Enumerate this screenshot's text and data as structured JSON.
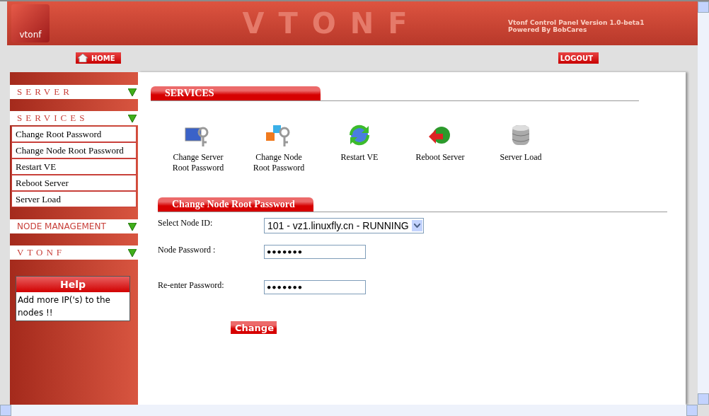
{
  "header": {
    "logo_text": "vtonf",
    "title": "VTONF",
    "version": "Vtonf Control Panel Version  1.0-beta1",
    "powered_by": "Powered By BobCares"
  },
  "nav": [
    {
      "kind": "home",
      "label": "HOME"
    },
    {
      "kind": "plain",
      "label": "LOGOUT"
    }
  ],
  "sidebar": {
    "sections": [
      {
        "title": "SERVER",
        "kind": "spaced"
      },
      {
        "title": "SERVICES",
        "kind": "spaced",
        "items": [
          "Change Root Password",
          "Change Node Root Password",
          "Restart VE",
          "Reboot Server",
          "Server Load"
        ]
      },
      {
        "title": "NODE MANAGEMENT",
        "kind": "plain"
      },
      {
        "title": "VTONF",
        "kind": "spaced"
      }
    ],
    "help": {
      "title": "Help",
      "text": "Add more IP('s) to the nodes !!"
    }
  },
  "services": {
    "title": "SERVICES",
    "items": [
      {
        "kind": "server-key",
        "label": "Change Server Root Password"
      },
      {
        "kind": "node-key",
        "label": "Change Node Root Password"
      },
      {
        "kind": "restart",
        "label": "Restart VE"
      },
      {
        "kind": "reboot",
        "label": "Reboot Server"
      },
      {
        "kind": "load",
        "label": "Server Load"
      }
    ]
  },
  "form": {
    "title": "Change Node Root Password",
    "fields": [
      {
        "kind": "select",
        "label": "Select Node ID:",
        "value": "101 - vz1.linuxfly.cn - RUNNING"
      },
      {
        "kind": "password",
        "label": "Node Password :",
        "value": "•••••••"
      },
      {
        "kind": "password",
        "label": "Re-enter Password:",
        "value": "•••••••"
      }
    ],
    "submit": "Change"
  }
}
